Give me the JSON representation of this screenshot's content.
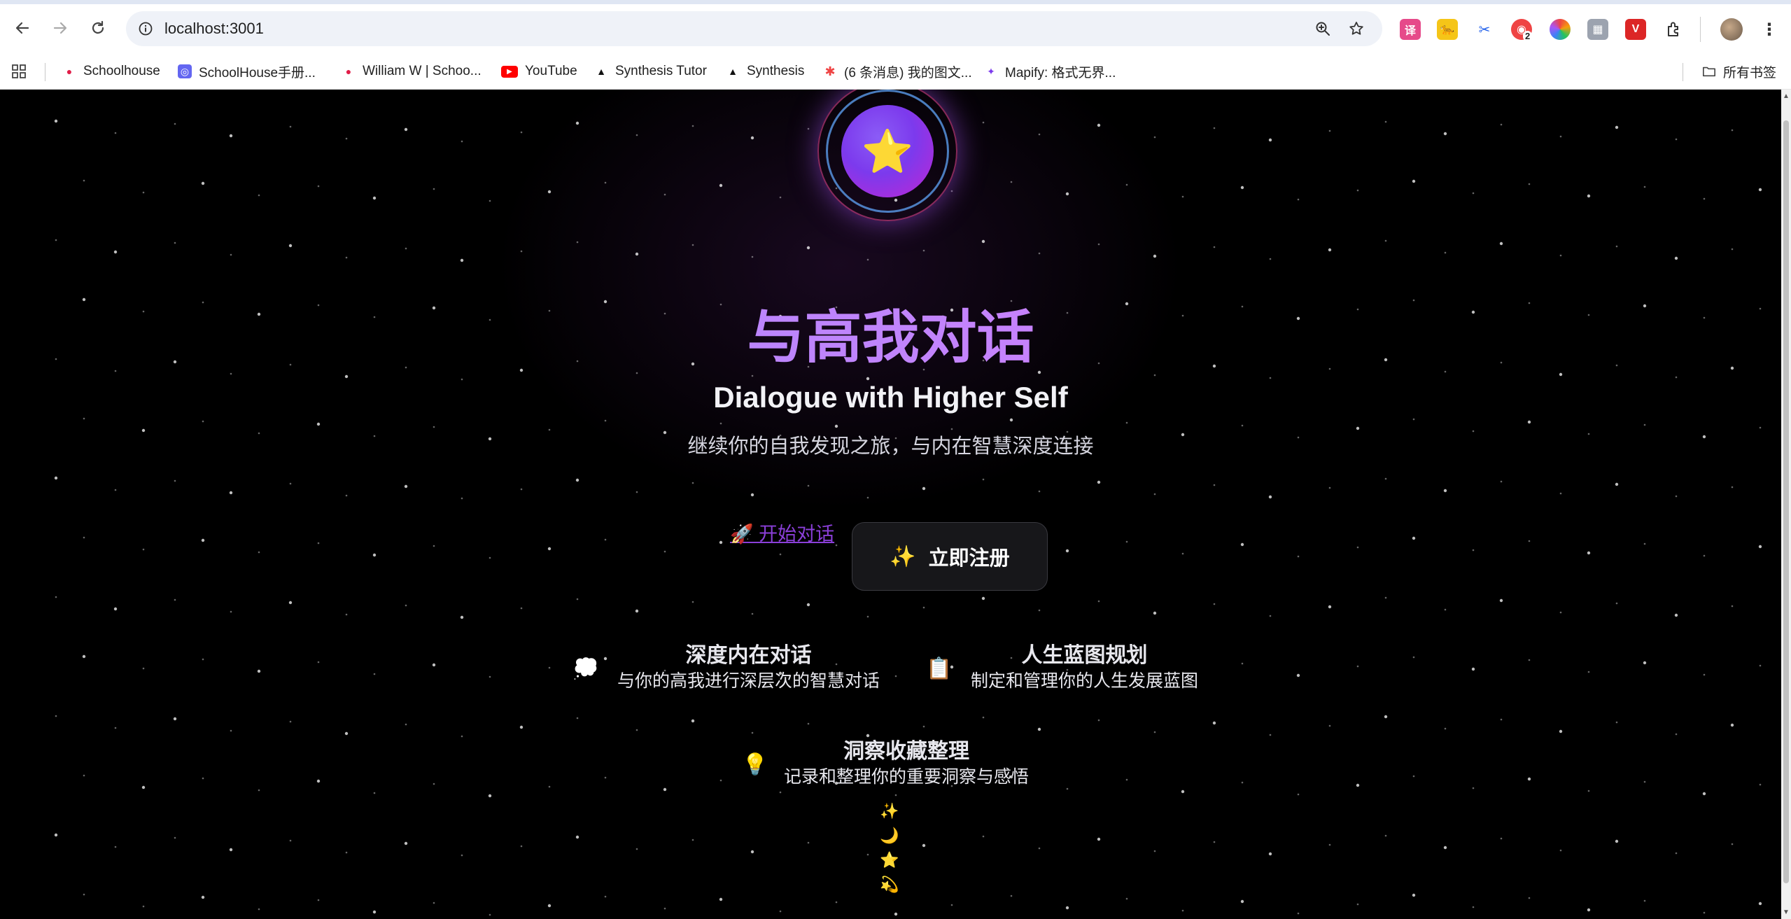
{
  "browser": {
    "url": "localhost:3001",
    "bookmarks": [
      {
        "label": "Schoolhouse",
        "icon": "schoolhouse-icon"
      },
      {
        "label": "SchoolHouse手册...",
        "icon": "schoolhouse-handbook-icon"
      },
      {
        "label": "William W | Schoo...",
        "icon": "schoolhouse-profile-icon"
      },
      {
        "label": "YouTube",
        "icon": "youtube-icon"
      },
      {
        "label": "Synthesis Tutor",
        "icon": "synthesis-tutor-icon"
      },
      {
        "label": "Synthesis",
        "icon": "synthesis-icon"
      },
      {
        "label": "(6 条消息) 我的图文...",
        "icon": "messages-icon"
      },
      {
        "label": "Mapify: 格式无界...",
        "icon": "mapify-icon"
      }
    ],
    "all_bookmarks_label": "所有书签",
    "extension_badge": "2"
  },
  "hero": {
    "title": "与高我对话",
    "subtitle": "Dialogue with Higher Self",
    "tagline": "继续你的自我发现之旅，与内在智慧深度连接",
    "start_link": "🚀 开始对话",
    "signup_emoji": "✨",
    "signup_label": "立即注册"
  },
  "features": [
    {
      "icon": "💭",
      "title": "深度内在对话",
      "desc": "与你的高我进行深层次的智慧对话"
    },
    {
      "icon": "📋",
      "title": "人生蓝图规划",
      "desc": "制定和管理你的人生发展蓝图"
    },
    {
      "icon": "💡",
      "title": "洞察收藏整理",
      "desc": "记录和整理你的重要洞察与感悟"
    }
  ],
  "decorations": [
    "✨",
    "🌙",
    "⭐",
    "💫"
  ],
  "colors": {
    "accent_purple": "#a78bfa",
    "accent_pink": "#e879f9",
    "background": "#000000"
  }
}
